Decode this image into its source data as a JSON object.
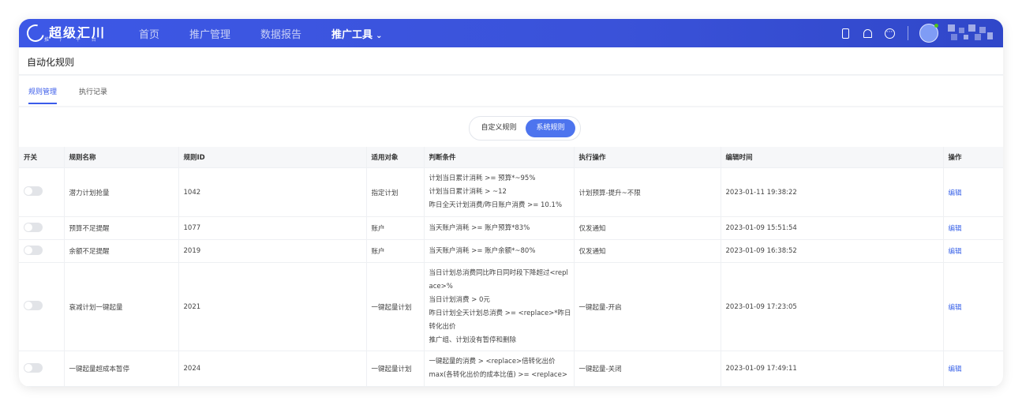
{
  "brand": {
    "name": "超级汇川",
    "subtitle": "推 广 平 台"
  },
  "nav": {
    "items": [
      {
        "label": "首页"
      },
      {
        "label": "推广管理"
      },
      {
        "label": "数据报告"
      },
      {
        "label": "推广工具",
        "active": true
      }
    ]
  },
  "header_icons": [
    "phone-icon",
    "bell-icon",
    "more-icon",
    "avatar"
  ],
  "page": {
    "title": "自动化规则"
  },
  "tabs": [
    {
      "label": "规则管理",
      "active": true
    },
    {
      "label": "执行记录",
      "active": false
    }
  ],
  "segment": {
    "custom": "自定义规则",
    "system": "系统规则",
    "selected": "系统规则"
  },
  "table": {
    "headers": [
      "开关",
      "规则名称",
      "规则ID",
      "适用对象",
      "判断条件",
      "执行操作",
      "编辑时间",
      "操作"
    ],
    "rows": [
      {
        "switch_on": false,
        "name": "潜力计划抢量",
        "id": "1042",
        "target": "指定计划",
        "conditions": [
          "计划当日累计消耗 >= 预算*~95%",
          "计划当日累计消耗 > ~12",
          "昨日全天计划消费/昨日账户消费 >= 10.1%"
        ],
        "action": "计划预算-提升~不限",
        "time": "2023-01-11 19:38:22",
        "op": "编辑"
      },
      {
        "switch_on": false,
        "name": "预算不足提醒",
        "id": "1077",
        "target": "账户",
        "conditions": [
          "当天账户消耗 >= 账户预算*83%"
        ],
        "action": "仅发通知",
        "time": "2023-01-09 15:51:54",
        "op": "编辑"
      },
      {
        "switch_on": false,
        "name": "余额不足提醒",
        "id": "2019",
        "target": "账户",
        "conditions": [
          "当天账户消耗 >= 账户余额*~80%"
        ],
        "action": "仅发通知",
        "time": "2023-01-09 16:38:52",
        "op": "编辑"
      },
      {
        "switch_on": false,
        "name": "衰减计划一键起量",
        "id": "2021",
        "target": "一键起量计划",
        "conditions": [
          "当日计划总消费同比昨日同时段下降超过<repl",
          "ace>%",
          "当日计划消费 > 0元",
          "昨日计划全天计划总消费 >= <replace>*昨日",
          "转化出价",
          "推广组、计划没有暂停和删除"
        ],
        "action": "一键起量-开启",
        "time": "2023-01-09 17:23:05",
        "op": "编辑"
      },
      {
        "switch_on": false,
        "name": "一键起量超成本暂停",
        "id": "2024",
        "target": "一键起量计划",
        "conditions": [
          "一键起量的消费 > <replace>倍转化出价",
          "max(各转化出价的成本比值) >= <replace>"
        ],
        "action": "一键起量-关闭",
        "time": "2023-01-09 17:49:11",
        "op": "编辑"
      }
    ]
  }
}
